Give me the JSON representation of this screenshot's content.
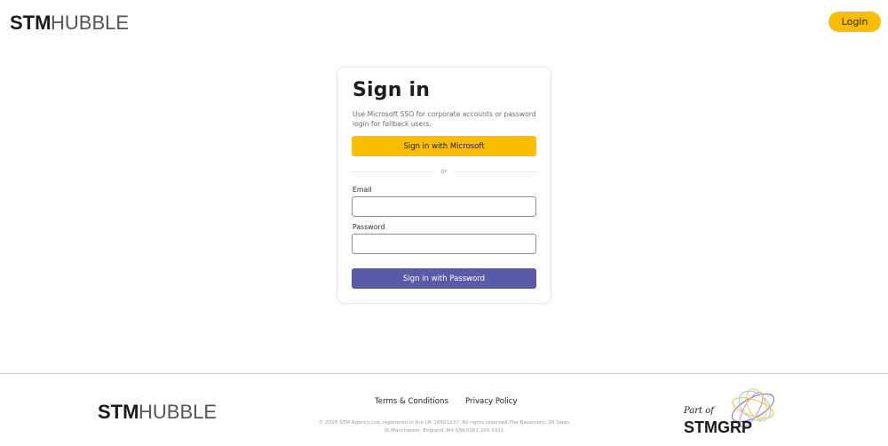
{
  "header": {
    "logo_text_bold": "STM",
    "logo_text_light": "HUBBLE",
    "login_label": "Login"
  },
  "signin": {
    "title": "Sign in",
    "description": "Use Microsoft SSO for corporate accounts or password login for fallback users.",
    "microsoft_button": "Sign in with Microsoft",
    "divider_text": "or",
    "email_label": "Email",
    "email_value": "",
    "password_label": "Password",
    "password_value": "",
    "password_button": "Sign in with Password"
  },
  "footer": {
    "logo_text_bold": "STM",
    "logo_text_light": "HUBBLE",
    "terms_label": "Terms & Conditions",
    "privacy_label": "Privacy Policy",
    "copyright_line1": "© 2026 STM Agency Ltd, registered in the UK 16501237. All rights reserved.The Basement, 20 Swan",
    "copyright_line2": "St,Manchester, England. M4 5JW.0161 205 3311",
    "group_part_of": "Part of",
    "group_name": "STMGRP"
  },
  "colors": {
    "accent_yellow": "#fbbd00",
    "accent_purple": "#5a5aa8",
    "text_dark": "#1d1d1d"
  },
  "icons": {
    "group_logo": "swirl-logo-icon"
  }
}
